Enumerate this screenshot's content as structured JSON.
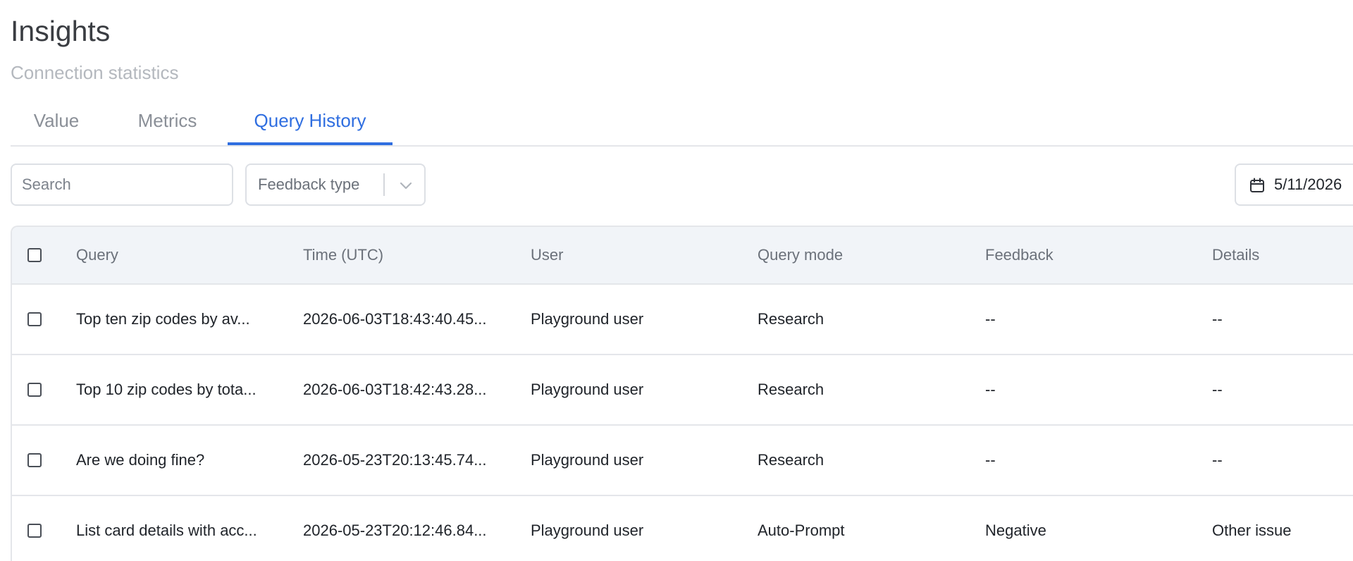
{
  "header": {
    "title": "Insights",
    "subtitle": "Connection statistics"
  },
  "tabs": [
    {
      "label": "Value",
      "active": false
    },
    {
      "label": "Metrics",
      "active": false
    },
    {
      "label": "Query History",
      "active": true
    }
  ],
  "filters": {
    "search_placeholder": "Search",
    "feedback_type_placeholder": "Feedback type",
    "date_value": "5/11/2026"
  },
  "table": {
    "columns": [
      "Query",
      "Time (UTC)",
      "User",
      "Query mode",
      "Feedback",
      "Details"
    ],
    "rows": [
      {
        "query": "Top ten zip codes by av...",
        "time": "2026-06-03T18:43:40.45...",
        "user": "Playground user",
        "mode": "Research",
        "feedback": "--",
        "details": "--"
      },
      {
        "query": "Top 10 zip codes by tota...",
        "time": "2026-06-03T18:42:43.28...",
        "user": "Playground user",
        "mode": "Research",
        "feedback": "--",
        "details": "--"
      },
      {
        "query": "Are we doing fine?",
        "time": "2026-05-23T20:13:45.74...",
        "user": "Playground user",
        "mode": "Research",
        "feedback": "--",
        "details": "--"
      },
      {
        "query": "List card details with acc...",
        "time": "2026-05-23T20:12:46.84...",
        "user": "Playground user",
        "mode": "Auto-Prompt",
        "feedback": "Negative",
        "details": "Other issue"
      }
    ]
  },
  "colors": {
    "accent": "#2f6ee0",
    "header_bg": "#f1f4f8",
    "border": "#e4e6ea"
  },
  "icons": {
    "select_chevron": "chevron-down-icon",
    "date": "calendar-icon"
  }
}
